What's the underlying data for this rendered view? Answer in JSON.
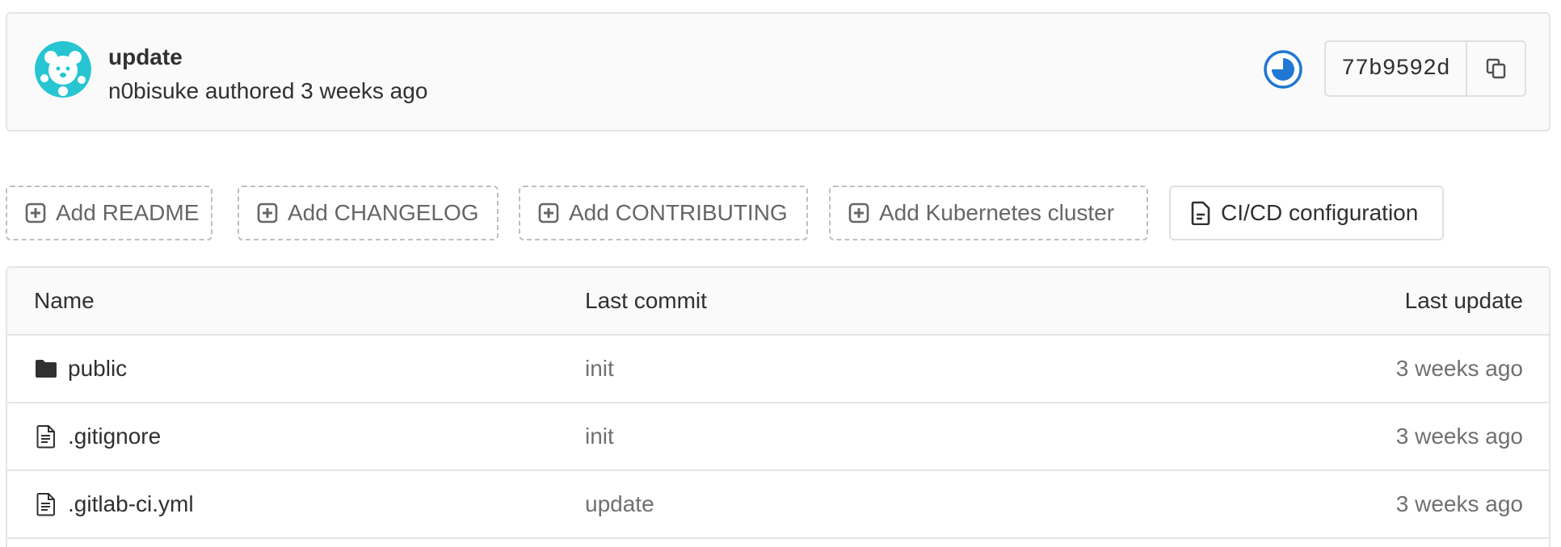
{
  "commit": {
    "title": "update",
    "meta": "n0bisuke authored 3 weeks ago",
    "sha": "77b9592d",
    "avatar_icon": "avatar-identicon",
    "pipeline_icon": "pipeline-running-icon",
    "copy_icon": "copy-icon"
  },
  "actions": {
    "add_readme": "Add README",
    "add_changelog": "Add CHANGELOG",
    "add_contributing": "Add CONTRIBUTING",
    "add_kubernetes": "Add Kubernetes cluster",
    "cicd_config": "CI/CD configuration",
    "add_icon": "plus-square-icon",
    "cicd_icon": "file-document-icon"
  },
  "table": {
    "columns": {
      "name": "Name",
      "last_commit": "Last commit",
      "last_update": "Last update"
    },
    "rows": [
      {
        "name": "public",
        "type": "folder",
        "icon": "folder-icon",
        "last_commit": "init",
        "last_update": "3 weeks ago"
      },
      {
        "name": ".gitignore",
        "type": "file",
        "icon": "file-icon",
        "last_commit": "init",
        "last_update": "3 weeks ago"
      },
      {
        "name": ".gitlab-ci.yml",
        "type": "file",
        "icon": "file-icon",
        "last_commit": "update",
        "last_update": "3 weeks ago"
      }
    ]
  },
  "colors": {
    "accent_pipeline": "#1f78d1",
    "avatar": "#27c5d2",
    "border": "#e5e5e5",
    "muted_text": "#707070"
  }
}
